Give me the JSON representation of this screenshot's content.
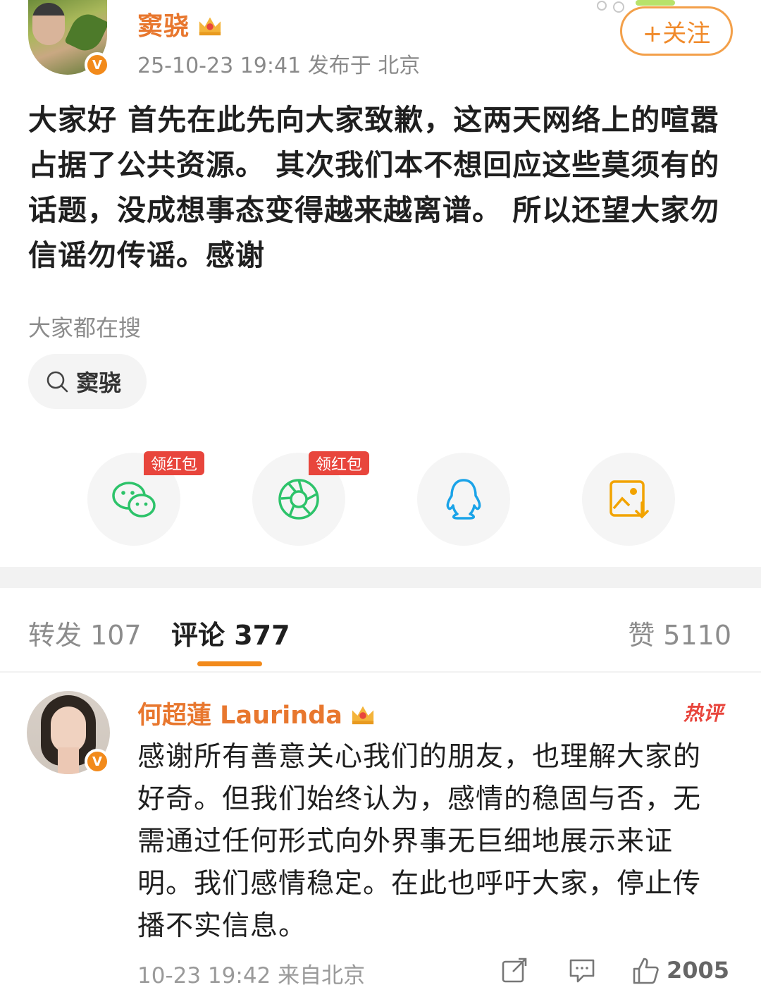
{
  "post": {
    "author": "窦骁",
    "meta": "25-10-23 19:41  发布于 北京",
    "follow_label": "+关注",
    "text": "大家好 首先在此先向大家致歉，这两天网络上的喧嚣占据了公共资源。 其次我们本不想回应这些莫须有的话题，没成想事态变得越来越离谱。 所以还望大家勿信谣勿传谣。感谢",
    "trending_label": "大家都在搜",
    "trending_chip": "窦骁"
  },
  "share": {
    "redpack_label": "领红包",
    "items": [
      {
        "icon": "wechat-icon"
      },
      {
        "icon": "moments-icon"
      },
      {
        "icon": "qq-icon"
      },
      {
        "icon": "save-image-icon"
      }
    ],
    "colors": {
      "wechat": "#2dc36a",
      "moments": "#2dc36a",
      "qq": "#1aa3e8",
      "image": "#f2a300"
    }
  },
  "tabs": {
    "repost": "转发 107",
    "comments": "评论 377",
    "likes": "赞 5110"
  },
  "comment": {
    "author": "何超蓮 Laurinda",
    "hot_badge": "热评",
    "text": "感谢所有善意关心我们的朋友，也理解大家的好奇。但我们始终认为，感情的稳固与否，无需通过任何形式向外界事无巨细地展示来证明。我们感情稳定。在此也呼吁大家，停止传播不实信息。",
    "meta": "10-23 19:42  来自北京",
    "like_count": "2005"
  },
  "colors": {
    "accent": "#f28a1b",
    "name": "#e8772e",
    "hot": "#e8453c"
  }
}
